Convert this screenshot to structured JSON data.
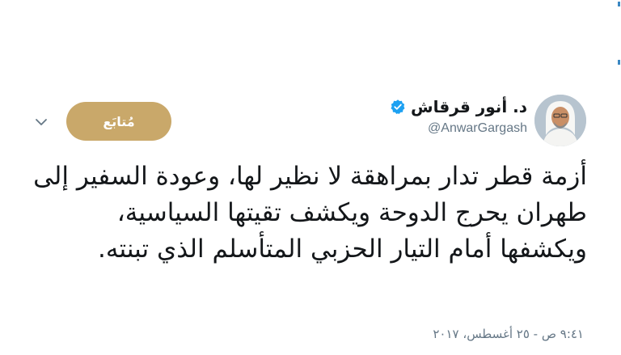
{
  "tweet": {
    "author": {
      "display_name": "د. أنور قرقاش",
      "username": "@AnwarGargash",
      "verified": true,
      "avatar_icon": "user-photo"
    },
    "follow_label": "مُتابَع",
    "menu_icon": "chevron-down-icon",
    "text": "أزمة قطر تدار بمراهقة لا نظير لها، وعودة السفير إلى طهران يحرج الدوحة ويكشف تقيتها السياسية، ويكشفها أمام التيار الحزبي المتأسلم الذي تبنته.",
    "timestamp": "٩:٤١ ص - ٢٥ أغسطس، ٢٠١٧"
  },
  "colors": {
    "follow_button_bg": "#c9a86a",
    "verified_blue": "#1da1f2",
    "secondary_text": "#657786",
    "primary_text": "#14171a"
  }
}
